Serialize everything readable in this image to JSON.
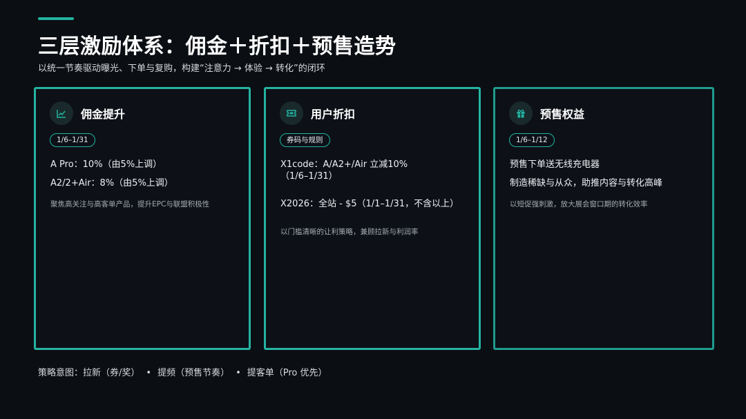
{
  "header": {
    "title": "三层激励体系：佣金＋折扣＋预售造势",
    "subtitle": "以统一节奏驱动曝光、下单与复购，构建“注意力 → 体验 → 转化”的闭环"
  },
  "cards": [
    {
      "icon": "chart-line-icon",
      "title": "佣金提升",
      "badge": "1/6–1/31",
      "lines": [
        "A Pro：10%（由5%上调）",
        "A2/2+Air：8%（由5%上调）"
      ],
      "note": "聚焦高关注与高客单产品，提升EPC与联盟积极性"
    },
    {
      "icon": "ticket-icon",
      "title": "用户折扣",
      "badge": "券码与规则",
      "lines": [
        "X1code：A/A2+/Air 立减10%",
        "（1/6–1/31）",
        "X2026：全站 - $5（1/1–1/31，不含以上）"
      ],
      "note": "以门槛清晰的让利策略，兼顾拉新与利润率"
    },
    {
      "icon": "gift-icon",
      "title": "预售权益",
      "badge": "1/6–1/12",
      "lines": [
        "预售下单送无线充电器",
        "制造稀缺与从众，助推内容与转化高峰"
      ],
      "note": "以短促强刺激，放大展会窗口期的转化效率"
    }
  ],
  "footer": {
    "label": "策略意图：",
    "items": [
      "拉新（券/奖）",
      "提频（预售节奏）",
      "提客单（Pro 优先）"
    ],
    "separator": "•"
  },
  "colors": {
    "accent": "#22b3a0",
    "background": "#0b0e13"
  }
}
